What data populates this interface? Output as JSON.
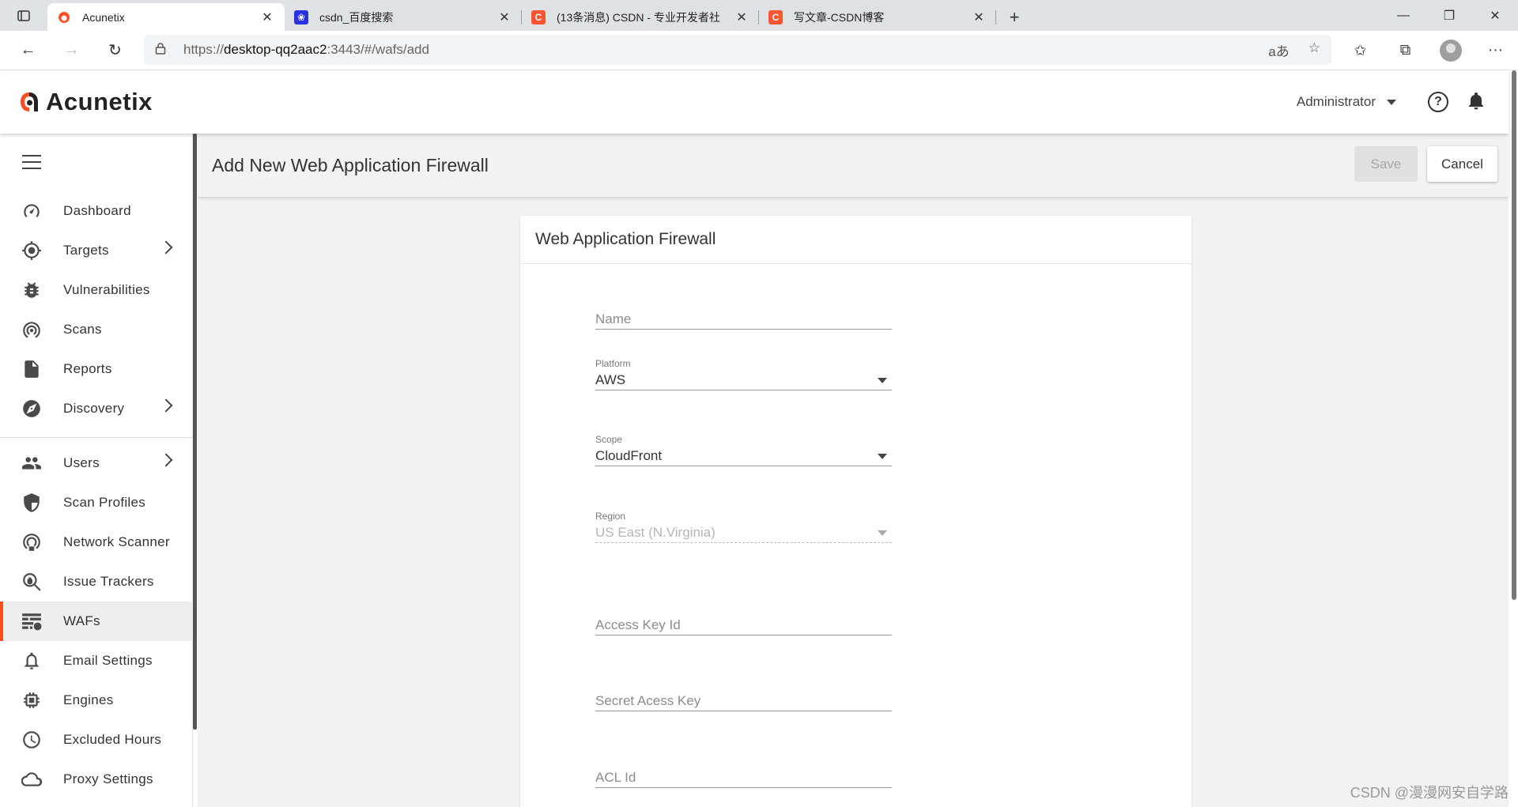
{
  "browser": {
    "tabs": [
      {
        "title": "Acunetix",
        "active": true,
        "icon": "acunetix-favicon"
      },
      {
        "title": "csdn_百度搜索",
        "active": false,
        "icon": "baidu-favicon"
      },
      {
        "title": "(13条消息) CSDN - 专业开发者社",
        "active": false,
        "icon": "csdn-favicon"
      },
      {
        "title": "写文章-CSDN博客",
        "active": false,
        "icon": "csdn-favicon"
      }
    ],
    "url_prefix": "https://",
    "url_host": "desktop-qq2aac2",
    "url_rest": ":3443/#/wafs/add",
    "colors": {
      "csdn": "#fc5531",
      "baidu": "#2932e1"
    }
  },
  "app": {
    "logo_text": "Acunetix",
    "user_menu": "Administrator",
    "accent": "#ff4d24"
  },
  "sidebar": {
    "items": [
      {
        "label": "Dashboard",
        "icon": "dashboard-icon",
        "chevron": false
      },
      {
        "label": "Targets",
        "icon": "target-icon",
        "chevron": true
      },
      {
        "label": "Vulnerabilities",
        "icon": "bug-icon",
        "chevron": false
      },
      {
        "label": "Scans",
        "icon": "radar-icon",
        "chevron": false
      },
      {
        "label": "Reports",
        "icon": "report-icon",
        "chevron": false
      },
      {
        "label": "Discovery",
        "icon": "compass-icon",
        "chevron": true
      },
      {
        "label": "Users",
        "icon": "users-icon",
        "chevron": true
      },
      {
        "label": "Scan Profiles",
        "icon": "shield-icon",
        "chevron": false
      },
      {
        "label": "Network Scanner",
        "icon": "network-scanner-icon",
        "chevron": false
      },
      {
        "label": "Issue Trackers",
        "icon": "issue-tracker-icon",
        "chevron": false
      },
      {
        "label": "WAFs",
        "icon": "firewall-icon",
        "chevron": false,
        "active": true
      },
      {
        "label": "Email Settings",
        "icon": "bell-icon",
        "chevron": false
      },
      {
        "label": "Engines",
        "icon": "chip-icon",
        "chevron": false
      },
      {
        "label": "Excluded Hours",
        "icon": "clock-icon",
        "chevron": false
      },
      {
        "label": "Proxy Settings",
        "icon": "cloud-icon",
        "chevron": false
      }
    ]
  },
  "page": {
    "title": "Add New Web Application Firewall",
    "save_label": "Save",
    "cancel_label": "Cancel",
    "card_title": "Web Application Firewall",
    "fields": {
      "name": {
        "placeholder": "Name",
        "value": ""
      },
      "platform": {
        "label": "Platform",
        "value": "AWS"
      },
      "scope": {
        "label": "Scope",
        "value": "CloudFront"
      },
      "region": {
        "label": "Region",
        "value": "US East (N.Virginia)",
        "disabled": true
      },
      "access_key": {
        "placeholder": "Access Key Id",
        "value": ""
      },
      "secret_key": {
        "placeholder": "Secret Acess Key",
        "value": ""
      },
      "acl_id": {
        "placeholder": "ACL Id",
        "value": ""
      }
    }
  },
  "watermark": "CSDN @漫漫网安自学路"
}
